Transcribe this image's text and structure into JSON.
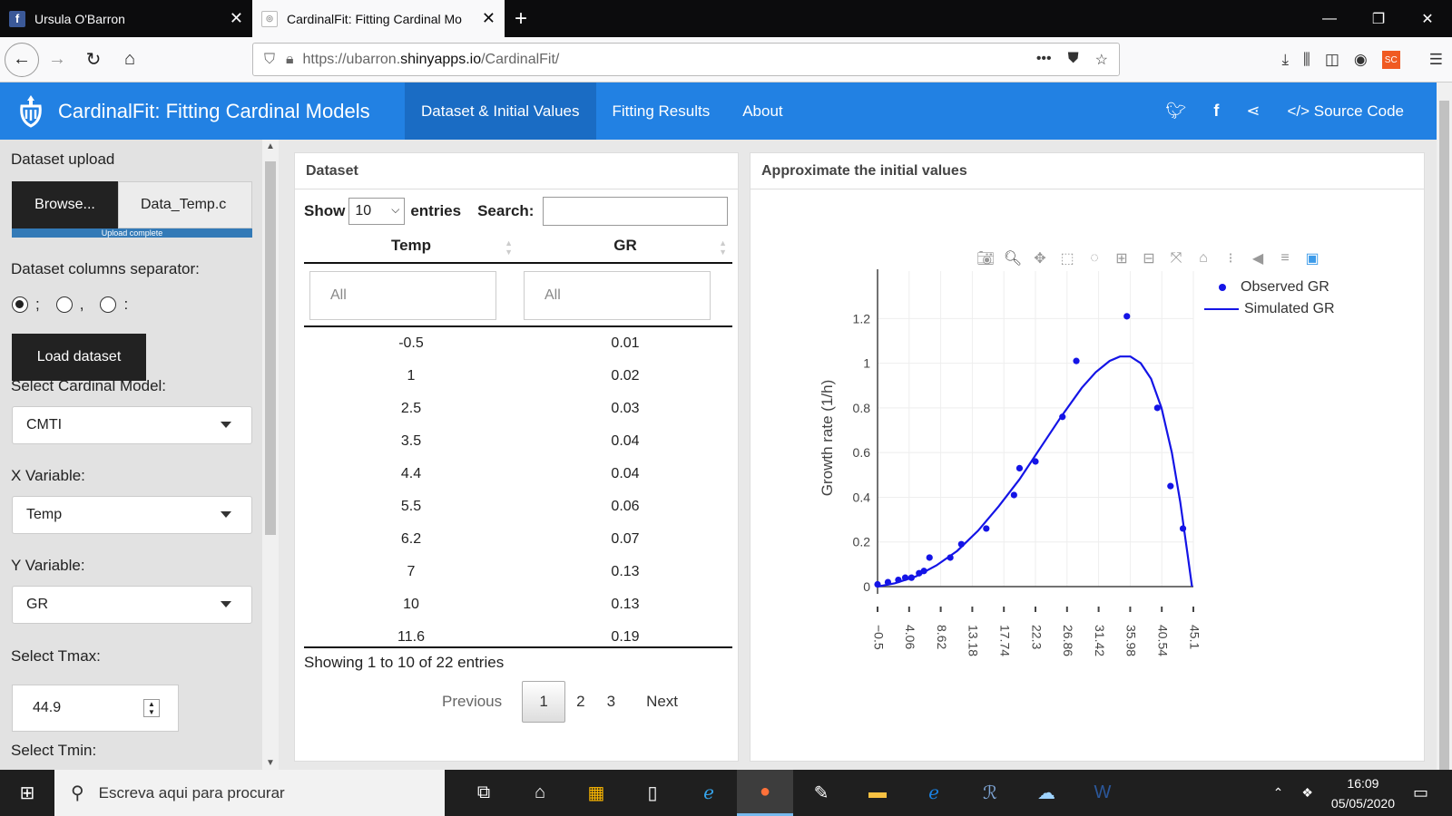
{
  "browser": {
    "tabs": [
      {
        "title": "Ursula O'Barron",
        "active": false,
        "icon": "facebook-favicon"
      },
      {
        "title": "CardinalFit: Fitting Cardinal Mo",
        "active": true,
        "icon": "shiny-favicon"
      }
    ],
    "url_prefix": "https://ubarron.",
    "url_domain": "shinyapps.io",
    "url_path": "/CardinalFit/"
  },
  "app": {
    "title": "CardinalFit: Fitting Cardinal Models",
    "nav": [
      "Dataset & Initial Values",
      "Fitting Results",
      "About"
    ],
    "active_nav": 0,
    "source_code": "Source Code",
    "accent": "#2281e3"
  },
  "sidebar": {
    "upload_label": "Dataset upload",
    "browse": "Browse...",
    "filename": "Data_Temp.c",
    "progress_text": "Upload complete",
    "progress_fraction": 1,
    "separator_label": "Dataset columns separator:",
    "separators": [
      ";",
      ",",
      ":"
    ],
    "selected_separator": 0,
    "load_button": "Load dataset",
    "model_label": "Select Cardinal Model:",
    "model_value": "CMTI",
    "x_label": "X Variable:",
    "x_value": "Temp",
    "y_label": "Y Variable:",
    "y_value": "GR",
    "tmax_label": "Select Tmax:",
    "tmax_value": "44.9",
    "tmin_label": "Select Tmin:"
  },
  "dataset": {
    "title": "Dataset",
    "show": "Show",
    "length": "10",
    "entries": "entries",
    "search": "Search:",
    "columns": [
      "Temp",
      "GR"
    ],
    "filter_placeholder": "All",
    "rows": [
      [
        "-0.5",
        "0.01"
      ],
      [
        "1",
        "0.02"
      ],
      [
        "2.5",
        "0.03"
      ],
      [
        "3.5",
        "0.04"
      ],
      [
        "4.4",
        "0.04"
      ],
      [
        "5.5",
        "0.06"
      ],
      [
        "6.2",
        "0.07"
      ],
      [
        "7",
        "0.13"
      ],
      [
        "10",
        "0.13"
      ],
      [
        "11.6",
        "0.19"
      ]
    ],
    "info": "Showing 1 to 10 of 22 entries",
    "pager": {
      "previous": "Previous",
      "pages": [
        "1",
        "2",
        "3"
      ],
      "current": "1",
      "next": "Next"
    }
  },
  "plot_panel": {
    "title": "Approximate the initial values",
    "legend": [
      "Observed GR",
      "Simulated GR"
    ]
  },
  "chart_data": {
    "type": "scatter",
    "ylabel": "Growth rate (1/h)",
    "xlabel": "",
    "xlim": [
      -0.5,
      45.1
    ],
    "ylim": [
      0,
      1.25
    ],
    "xticks": [
      "-0.5",
      "4.06",
      "8.62",
      "13.18",
      "17.74",
      "22.3",
      "26.86",
      "31.42",
      "35.98",
      "40.54",
      "45.1"
    ],
    "yticks": [
      "0",
      "0.2",
      "0.4",
      "0.6",
      "0.8",
      "1",
      "1.2"
    ],
    "color": "#1414e6",
    "series": [
      {
        "name": "Observed GR",
        "mode": "markers",
        "x": [
          -0.5,
          1,
          2.5,
          3.5,
          4.4,
          5.5,
          6.2,
          7,
          10,
          11.6,
          15.2,
          19.2,
          20,
          22.3,
          26.2,
          28.2,
          35.5,
          39.9,
          41.8,
          43.6
        ],
        "y": [
          0.01,
          0.02,
          0.03,
          0.04,
          0.04,
          0.06,
          0.07,
          0.13,
          0.13,
          0.19,
          0.26,
          0.41,
          0.53,
          0.56,
          0.76,
          1.01,
          1.21,
          0.8,
          0.45,
          0.26
        ]
      },
      {
        "name": "Simulated GR",
        "mode": "lines",
        "x": [
          -0.5,
          2,
          5,
          8,
          11,
          14,
          17,
          20,
          23,
          26,
          29,
          31,
          33,
          34.5,
          36,
          37.5,
          39,
          40.5,
          42,
          43.2,
          44.2,
          44.9
        ],
        "y": [
          0,
          0.015,
          0.045,
          0.095,
          0.16,
          0.25,
          0.36,
          0.48,
          0.62,
          0.76,
          0.89,
          0.96,
          1.01,
          1.03,
          1.03,
          1.0,
          0.93,
          0.8,
          0.6,
          0.38,
          0.16,
          0.0
        ]
      }
    ]
  },
  "taskbar": {
    "search_placeholder": "Escreva aqui para procurar",
    "time": "16:09",
    "date": "05/05/2020"
  }
}
